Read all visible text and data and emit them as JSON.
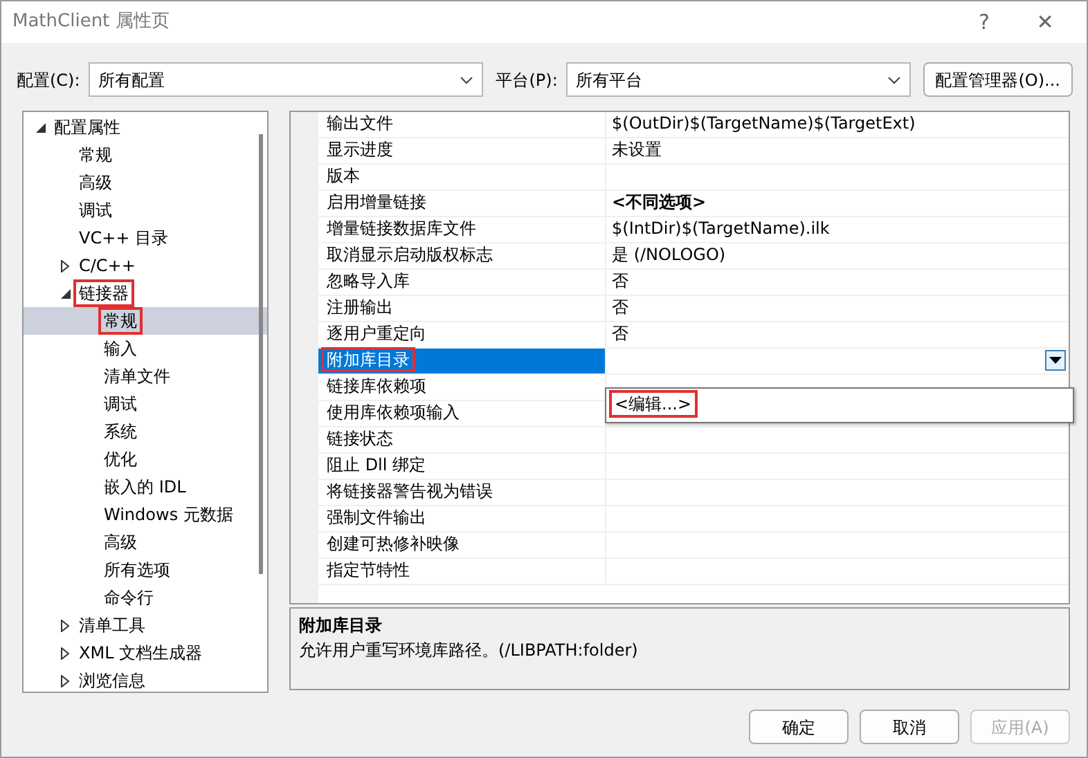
{
  "window": {
    "title": "MathClient 属性页",
    "help": "?",
    "close": "✕"
  },
  "config": {
    "label": "配置(C):",
    "value": "所有配置"
  },
  "platform": {
    "label": "平台(P):",
    "value": "所有平台"
  },
  "config_manager": "配置管理器(O)...",
  "tree": [
    {
      "label": "配置属性",
      "expanded": true,
      "selected": false,
      "annotated": false,
      "children": [
        {
          "label": "常规",
          "selected": false,
          "annotated": false
        },
        {
          "label": "高级",
          "selected": false,
          "annotated": false
        },
        {
          "label": "调试",
          "selected": false,
          "annotated": false
        },
        {
          "label": "VC++ 目录",
          "selected": false,
          "annotated": false
        },
        {
          "label": "C/C++",
          "expanded": false,
          "selected": false,
          "annotated": false
        },
        {
          "label": "链接器",
          "expanded": true,
          "selected": false,
          "annotated": true,
          "children": [
            {
              "label": "常规",
              "selected": true,
              "annotated": true
            },
            {
              "label": "输入",
              "selected": false,
              "annotated": false
            },
            {
              "label": "清单文件",
              "selected": false,
              "annotated": false
            },
            {
              "label": "调试",
              "selected": false,
              "annotated": false
            },
            {
              "label": "系统",
              "selected": false,
              "annotated": false
            },
            {
              "label": "优化",
              "selected": false,
              "annotated": false
            },
            {
              "label": "嵌入的 IDL",
              "selected": false,
              "annotated": false
            },
            {
              "label": "Windows 元数据",
              "selected": false,
              "annotated": false
            },
            {
              "label": "高级",
              "selected": false,
              "annotated": false
            },
            {
              "label": "所有选项",
              "selected": false,
              "annotated": false
            },
            {
              "label": "命令行",
              "selected": false,
              "annotated": false
            }
          ]
        },
        {
          "label": "清单工具",
          "expanded": false,
          "selected": false,
          "annotated": false
        },
        {
          "label": "XML 文档生成器",
          "expanded": false,
          "selected": false,
          "annotated": false
        },
        {
          "label": "浏览信息",
          "expanded": false,
          "selected": false,
          "annotated": false
        }
      ]
    }
  ],
  "properties": [
    {
      "name": "输出文件",
      "value": "$(OutDir)$(TargetName)$(TargetExt)",
      "bold": false,
      "selected": false,
      "annotated": false
    },
    {
      "name": "显示进度",
      "value": "未设置",
      "bold": false,
      "selected": false,
      "annotated": false
    },
    {
      "name": "版本",
      "selected": false,
      "annotated": false
    },
    {
      "name": "启用增量链接",
      "value": "<不同选项>",
      "bold": true,
      "selected": false,
      "annotated": false
    },
    {
      "name": "增量链接数据库文件",
      "value": "$(IntDir)$(TargetName).ilk",
      "bold": false,
      "selected": false,
      "annotated": false
    },
    {
      "name": "取消显示启动版权标志",
      "value": "是 (/NOLOGO)",
      "bold": false,
      "selected": false,
      "annotated": false
    },
    {
      "name": "忽略导入库",
      "value": "否",
      "bold": false,
      "selected": false,
      "annotated": false
    },
    {
      "name": "注册输出",
      "value": "否",
      "bold": false,
      "selected": false,
      "annotated": false
    },
    {
      "name": "逐用户重定向",
      "value": "否",
      "bold": false,
      "selected": false,
      "annotated": false
    },
    {
      "name": "附加库目录",
      "selected": true,
      "annotated": true,
      "dropdown": {
        "options": [
          {
            "label": "<编辑...>",
            "annotated": true
          }
        ]
      }
    },
    {
      "name": "链接库依赖项",
      "selected": false,
      "annotated": false
    },
    {
      "name": "使用库依赖项输入",
      "selected": false,
      "annotated": false
    },
    {
      "name": "链接状态",
      "selected": false,
      "annotated": false
    },
    {
      "name": "阻止 Dll 绑定",
      "selected": false,
      "annotated": false
    },
    {
      "name": "将链接器警告视为错误",
      "selected": false,
      "annotated": false
    },
    {
      "name": "强制文件输出",
      "selected": false,
      "annotated": false
    },
    {
      "name": "创建可热修补映像",
      "selected": false,
      "annotated": false
    },
    {
      "name": "指定节特性",
      "selected": false,
      "annotated": false
    }
  ],
  "description": {
    "title": "附加库目录",
    "text": "允许用户重写环境库路径。(/LIBPATH:folder)"
  },
  "buttons": [
    {
      "label": "确定",
      "disabled": false
    },
    {
      "label": "取消",
      "disabled": false
    },
    {
      "label": "应用(A)",
      "disabled": true
    }
  ]
}
